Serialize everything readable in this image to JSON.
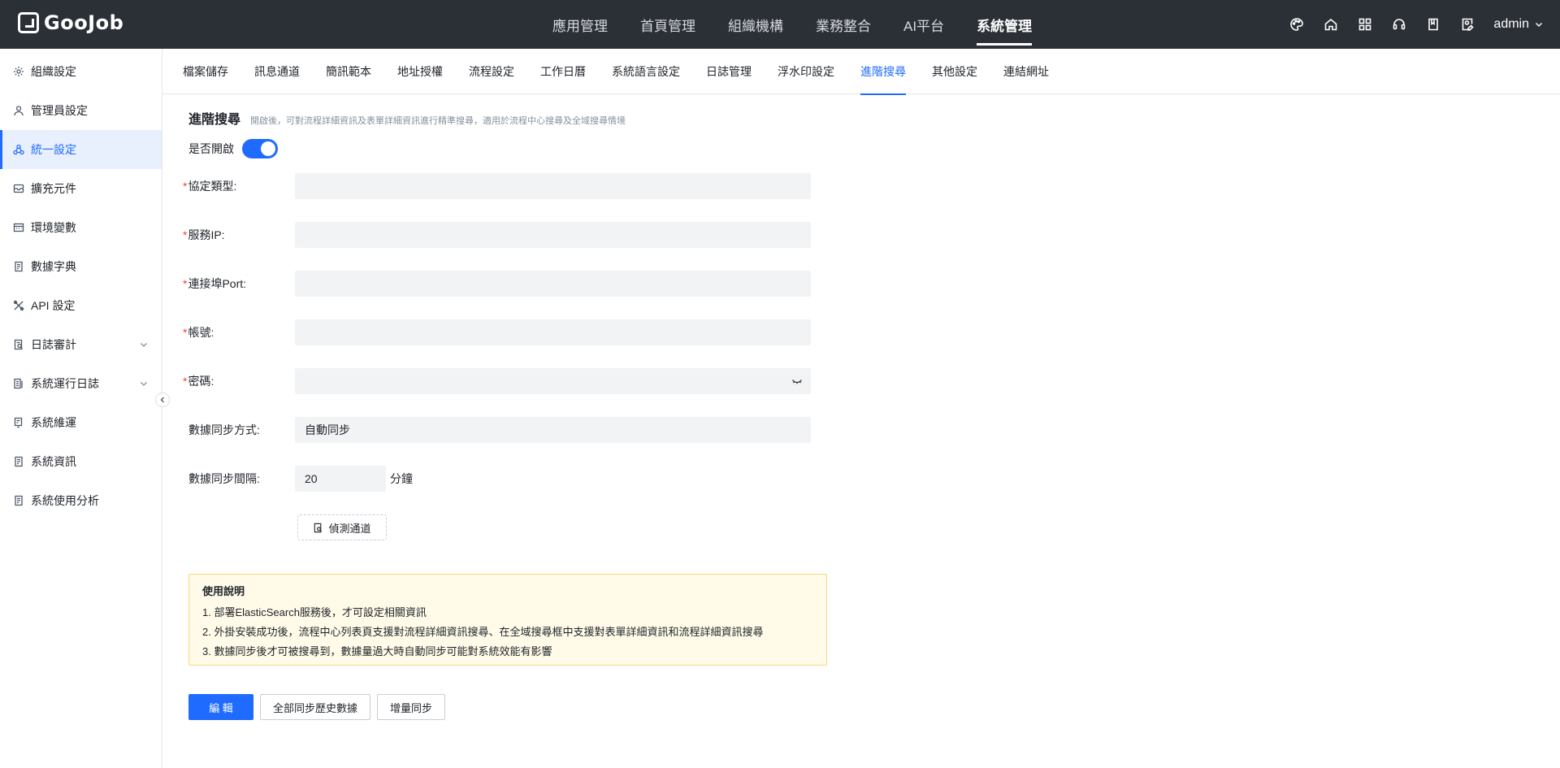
{
  "app": {
    "logo_text": "GooJob"
  },
  "topnav": {
    "items": [
      "應用管理",
      "首頁管理",
      "組織機構",
      "業務整合",
      "AI平台",
      "系統管理"
    ],
    "active": "系統管理"
  },
  "topright": {
    "icons": [
      "palette-icon",
      "home-icon",
      "apps-grid-icon",
      "headset-icon",
      "book-icon",
      "edit-user-icon"
    ],
    "user": "admin"
  },
  "sidebar": {
    "items": [
      {
        "label": "組織設定",
        "icon": "gear-icon"
      },
      {
        "label": "管理員設定",
        "icon": "user-icon"
      },
      {
        "label": "統一設定",
        "icon": "cluster-icon"
      },
      {
        "label": "擴充元件",
        "icon": "box-icon"
      },
      {
        "label": "環境變數",
        "icon": "variable-icon"
      },
      {
        "label": "數據字典",
        "icon": "dictionary-icon"
      },
      {
        "label": "API 設定",
        "icon": "api-icon"
      },
      {
        "label": "日誌審計",
        "icon": "audit-icon"
      },
      {
        "label": "系統運行日誌",
        "icon": "log-icon"
      },
      {
        "label": "系統維運",
        "icon": "maintenance-icon"
      },
      {
        "label": "系統資訊",
        "icon": "info-icon"
      },
      {
        "label": "系統使用分析",
        "icon": "analysis-icon"
      }
    ],
    "active": "統一設定"
  },
  "tabs": {
    "items": [
      "檔案儲存",
      "訊息通道",
      "簡訊範本",
      "地址授權",
      "流程設定",
      "工作日曆",
      "系統語言設定",
      "日誌管理",
      "浮水印設定",
      "進階搜尋",
      "其他設定",
      "連結網址"
    ],
    "active": "進階搜尋"
  },
  "section": {
    "title": "進階搜尋",
    "description": "開啟後，可對流程詳細資訊及表單詳細資訊進行精準搜尋，適用於流程中心搜尋及全域搜尋情境",
    "enable_label": "是否開啟",
    "enabled": true
  },
  "form": {
    "protocol_label": "協定類型:",
    "protocol_value": "",
    "ip_label": "服務IP:",
    "ip_value": "",
    "port_label": "連接埠Port:",
    "port_value": "",
    "account_label": "帳號:",
    "account_value": "",
    "password_label": "密碼:",
    "password_value": "",
    "sync_mode_label": "數據同步方式:",
    "sync_mode_value": "自動同步",
    "sync_interval_label": "數據同步間隔:",
    "sync_interval_value": "20",
    "sync_interval_unit": "分鐘",
    "detect_button": "偵測通道"
  },
  "notice": {
    "title": "使用說明",
    "lines": [
      "1. 部署ElasticSearch服務後，才可設定相關資訊",
      "2. 外掛安裝成功後，流程中心列表頁支援對流程詳細資訊搜尋、在全域搜尋框中支援對表單詳細資訊和流程詳細資訊搜尋",
      "3. 數據同步後才可被搜尋到，數據量過大時自動同步可能對系統效能有影響"
    ]
  },
  "actions": {
    "edit": "編 輯",
    "full_sync": "全部同步歷史數據",
    "incremental_sync": "增量同步"
  }
}
